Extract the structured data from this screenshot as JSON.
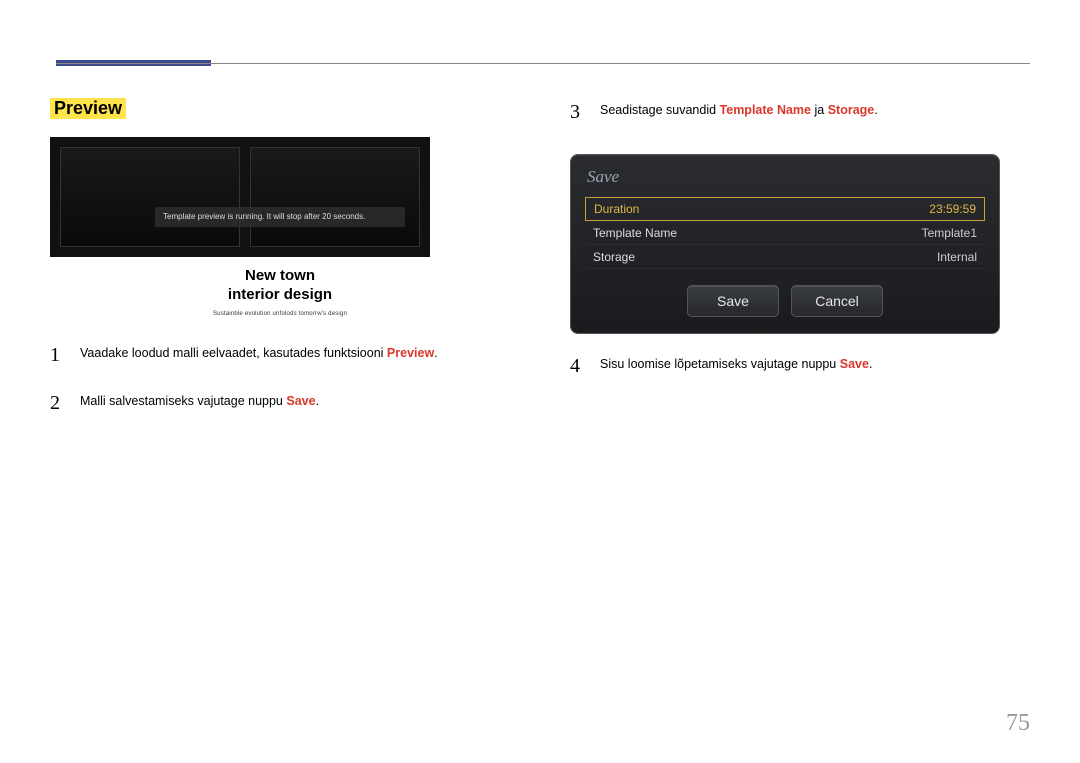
{
  "section_title": "Preview",
  "preview_message": "Template preview is running. It will stop after 20 seconds.",
  "caption_line1": "New town",
  "caption_line2": "interior design",
  "caption_sub": "Sustainble evolution unfolods tomorrw's design",
  "left_steps": [
    {
      "num": "1",
      "pre": "Vaadake loodud malli eelvaadet, kasutades funktsiooni ",
      "hl": "Preview",
      "post": "."
    },
    {
      "num": "2",
      "pre": "Malli salvestamiseks vajutage nuppu ",
      "hl": "Save",
      "post": "."
    }
  ],
  "right_steps": [
    {
      "num": "3",
      "pre": "Seadistage suvandid ",
      "hl": "Template Name",
      "mid": " ja ",
      "hl2": "Storage",
      "post": "."
    },
    {
      "num": "4",
      "pre": "Sisu loomise lõpetamiseks vajutage nuppu ",
      "hl": "Save",
      "post": "."
    }
  ],
  "dialog": {
    "title": "Save",
    "rows": [
      {
        "label": "Duration",
        "value": "23:59:59",
        "selected": true
      },
      {
        "label": "Template Name",
        "value": "Template1",
        "selected": false
      },
      {
        "label": "Storage",
        "value": "Internal",
        "selected": false
      }
    ],
    "buttons": {
      "save": "Save",
      "cancel": "Cancel"
    }
  },
  "page_number": "75"
}
